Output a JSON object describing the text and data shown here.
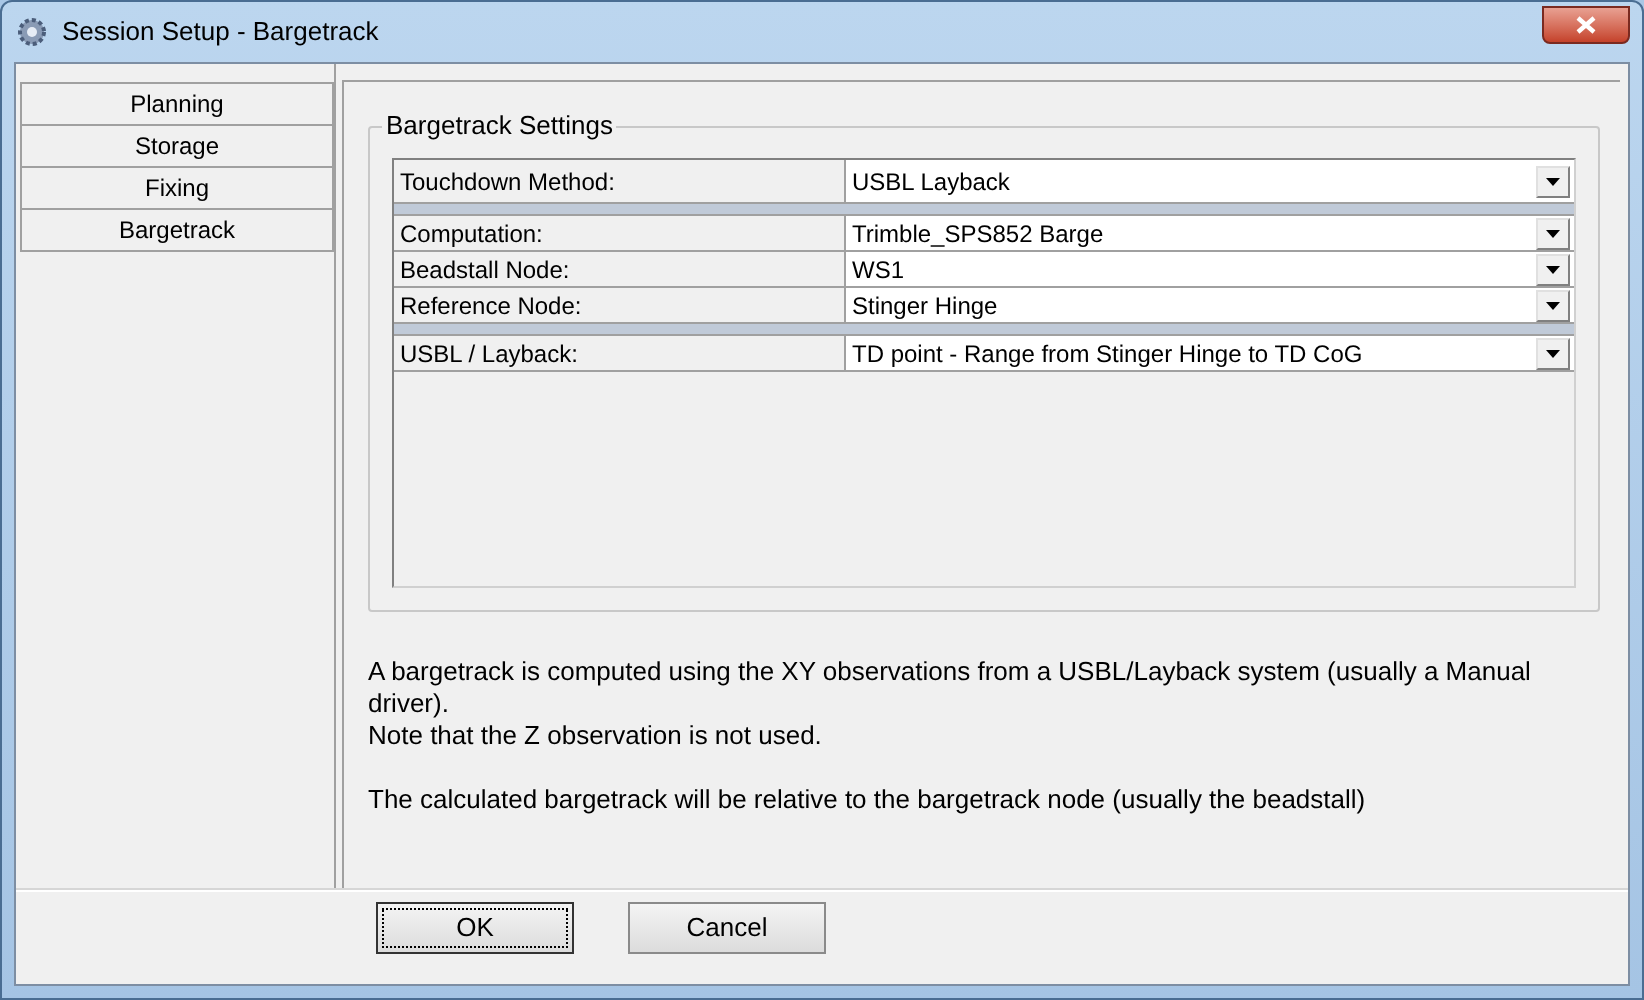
{
  "window": {
    "title": "Session Setup - Bargetrack"
  },
  "sidebar": {
    "items": [
      {
        "label": "Planning"
      },
      {
        "label": "Storage"
      },
      {
        "label": "Fixing"
      },
      {
        "label": "Bargetrack"
      }
    ]
  },
  "group": {
    "title": "Bargetrack Settings",
    "rows": [
      {
        "kind": "setting",
        "label": "Touchdown Method:",
        "value": "USBL Layback"
      },
      {
        "kind": "separator"
      },
      {
        "kind": "setting",
        "label": "Computation:",
        "value": "Trimble_SPS852 Barge"
      },
      {
        "kind": "setting",
        "label": "Beadstall Node:",
        "value": "WS1"
      },
      {
        "kind": "setting",
        "label": "Reference Node:",
        "value": "Stinger Hinge"
      },
      {
        "kind": "separator"
      },
      {
        "kind": "setting",
        "label": "USBL / Layback:",
        "value": "TD point - Range from Stinger Hinge to TD CoG"
      }
    ]
  },
  "description": {
    "paragraphs": [
      [
        "A bargetrack is computed using the XY observations from a USBL/Layback system (usually a Manual driver).",
        "Note that the Z observation is not used."
      ],
      [
        "The calculated bargetrack will be relative to the bargetrack node (usually the beadstall)"
      ]
    ]
  },
  "buttons": [
    {
      "label": "OK",
      "focused": true
    },
    {
      "label": "Cancel",
      "focused": false
    }
  ]
}
